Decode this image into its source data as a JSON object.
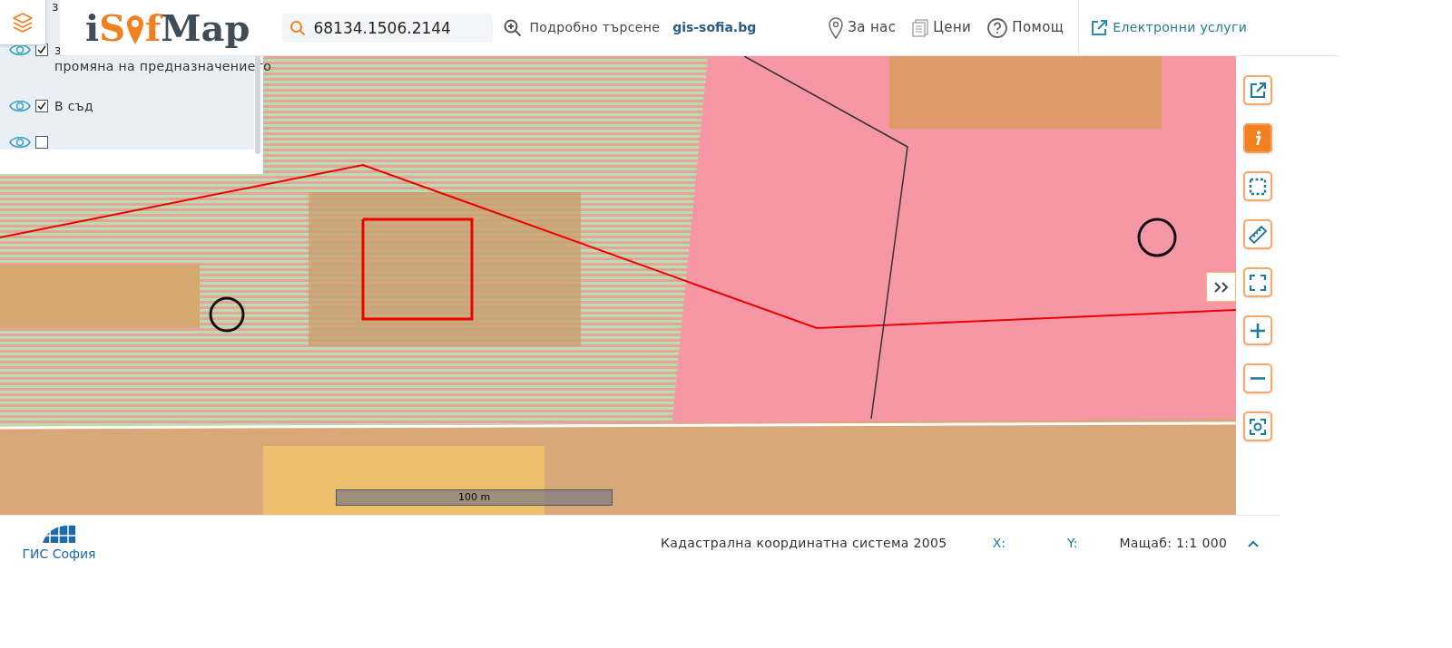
{
  "header": {
    "logo": {
      "part1": "i",
      "part2": "S",
      "part3": "f",
      "part4": "Map"
    },
    "search": {
      "value": "68134.1506.2144"
    },
    "advanced_search": "Подробно търсене",
    "site_link": "gis-sofia.bg",
    "nav": [
      {
        "kind": "pin",
        "label": "За нас"
      },
      {
        "kind": "list",
        "label": "Цени"
      },
      {
        "kind": "help",
        "label": "Помощ"
      }
    ],
    "services_link": "Електронни услуги"
  },
  "layer_panel": {
    "overflow_text": "з",
    "items": [
      {
        "lines": [
          "з",
          "промяна на предназначението"
        ],
        "visible": true,
        "checked": true
      },
      {
        "lines": [
          "В съд"
        ],
        "visible": true,
        "checked": true
      },
      {
        "visible": true,
        "checked": false
      }
    ]
  },
  "map": {
    "scale_label": "100 m"
  },
  "tools": [
    {
      "kind": "external",
      "selected": false
    },
    {
      "kind": "info",
      "selected": true
    },
    {
      "kind": "select",
      "selected": false
    },
    {
      "kind": "ruler",
      "selected": false
    },
    {
      "kind": "fullscreen",
      "selected": false
    },
    {
      "kind": "zoom_in",
      "selected": false
    },
    {
      "kind": "zoom_out",
      "selected": false
    },
    {
      "kind": "locate",
      "selected": false
    }
  ],
  "footer": {
    "logo_text": "ГИС София",
    "coordinate_system": "Кадастрална координатна система 2005",
    "x_label": "X:",
    "y_label": "Y:",
    "scale": "Мащаб: 1:1 000"
  }
}
